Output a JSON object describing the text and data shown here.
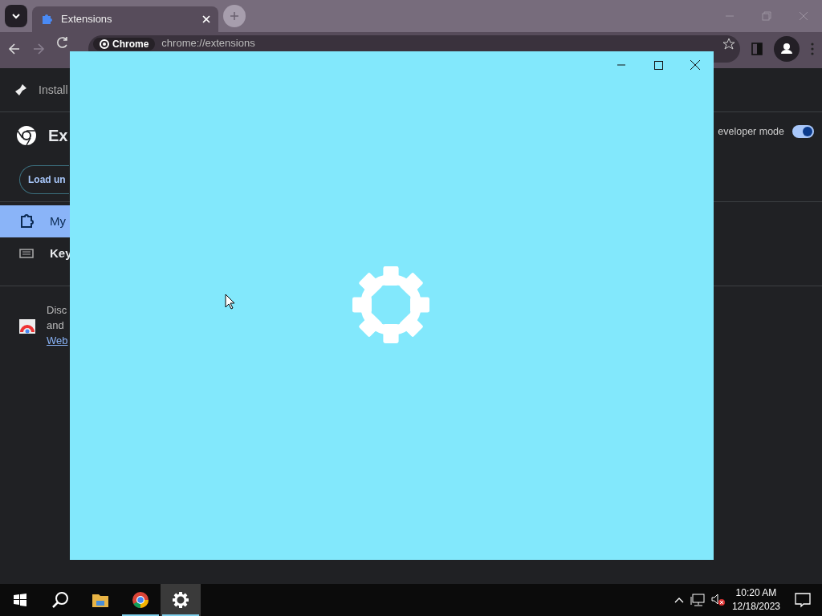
{
  "browser": {
    "tabs": [
      {
        "title": "Extensions",
        "selected": true
      }
    ],
    "omnibox": {
      "chip": "Chrome",
      "url": "chrome://extensions"
    }
  },
  "page": {
    "banner": "Install",
    "title": "Ex",
    "load_button": "Load un",
    "developer_mode": {
      "label": "eveloper mode",
      "on": true
    },
    "nav": [
      {
        "label": "My",
        "selected": true
      },
      {
        "label": "Key",
        "selected": false
      }
    ],
    "promo": {
      "lines": [
        "Disc",
        "and"
      ],
      "link": "Web"
    }
  },
  "taskbar": {
    "apps": [
      {
        "kind": "files",
        "selected": false
      },
      {
        "kind": "chrome",
        "selected": false
      },
      {
        "kind": "settings",
        "selected": true
      }
    ],
    "clock": {
      "time": "10:20 AM",
      "date": "12/18/2023"
    }
  }
}
